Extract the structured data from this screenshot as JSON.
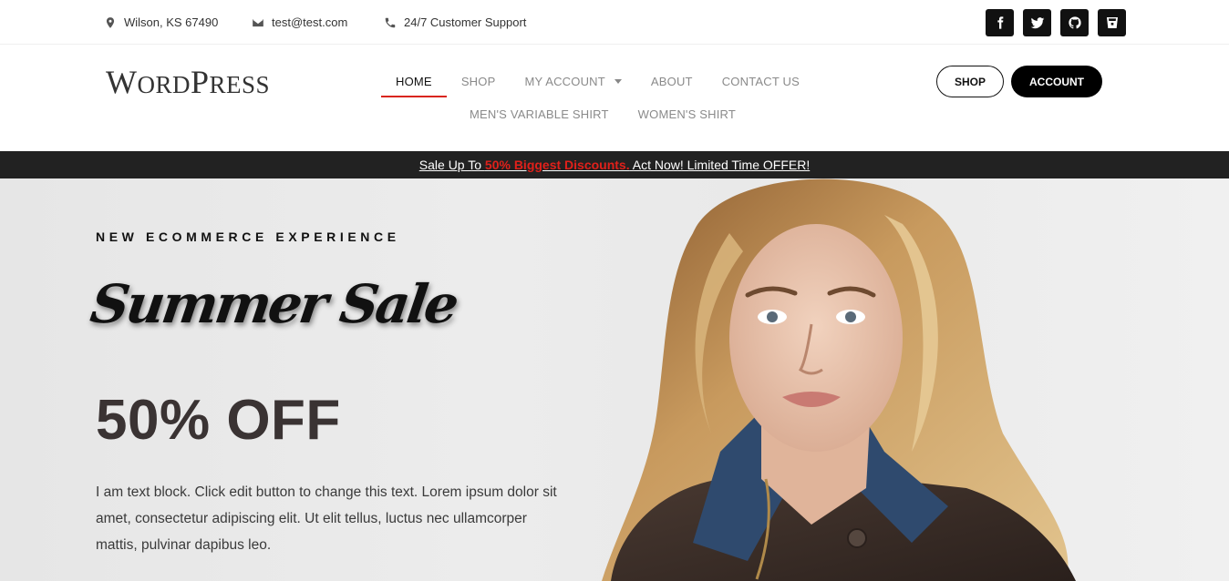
{
  "topbar": {
    "location": "Wilson, KS 67490",
    "email": "test@test.com",
    "support": "24/7 Customer Support",
    "socials": [
      "facebook-icon",
      "twitter-icon",
      "github-icon",
      "bucket-icon"
    ]
  },
  "header": {
    "logo_first": "W",
    "logo_mid": "ORD",
    "logo_p": "P",
    "logo_end": "RESS",
    "nav": {
      "home": "Home",
      "shop": "Shop",
      "my_account": "My Account",
      "about": "About",
      "contact": "Contact Us",
      "mens_shirt": "Men's Variable Shirt",
      "womens_shirt": "Women's Shirt"
    },
    "btn_shop": "Shop",
    "btn_account": "Account"
  },
  "announcement": {
    "prefix": "Sale Up To ",
    "highlight": "50% Biggest Discounts.",
    "suffix": " Act Now! Limited Time OFFER!"
  },
  "hero": {
    "eyebrow": "NEW ECOMMERCE EXPERIENCE",
    "title": "Summer Sale",
    "discount": "50% OFF",
    "body": "I am text block. Click edit button to change this text. Lorem ipsum dolor sit amet, consectetur adipiscing elit. Ut elit tellus, luctus nec ullamcorper mattis, pulvinar dapibus leo."
  },
  "colors": {
    "accent": "#d9251c",
    "dark": "#222222",
    "hero_bg": "#e8e8e8"
  }
}
